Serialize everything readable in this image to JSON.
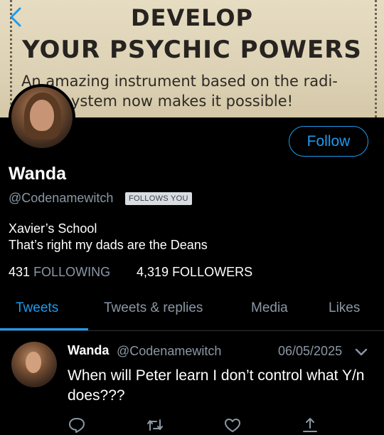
{
  "banner": {
    "headline1": "DEVELOP",
    "headline2": "YOUR PSYCHIC POWERS",
    "sub1": "An amazing instrument based on the radi-",
    "sub2": "ystem now makes it possible!"
  },
  "nav": {
    "back_icon": "chevron-left-icon"
  },
  "profile": {
    "name": "Wanda",
    "handle": "@Codenamewitch",
    "follows_you": "FOLLOWS YOU",
    "follow_label": "Follow",
    "bio_line1": "Xavier’s School",
    "bio_line2": "That’s right my dads are the Deans",
    "following_count": "431",
    "following_label": "FOLLOWING",
    "followers_count": "4,319",
    "followers_label": "FOLLOWERS"
  },
  "tabs": [
    {
      "label": "Tweets",
      "active": true
    },
    {
      "label": "Tweets & replies",
      "active": false
    },
    {
      "label": "Media",
      "active": false
    },
    {
      "label": "Likes",
      "active": false
    }
  ],
  "tweet": {
    "name": "Wanda",
    "handle": "@Codenamewitch",
    "date": "06/05/2025",
    "text": "When will Peter learn I don’t control what Y/n does???",
    "actions": [
      "reply-icon",
      "retweet-icon",
      "like-icon",
      "share-icon"
    ]
  },
  "colors": {
    "accent": "#1d9bf0",
    "muted": "#8b98a5",
    "background": "#000000"
  }
}
